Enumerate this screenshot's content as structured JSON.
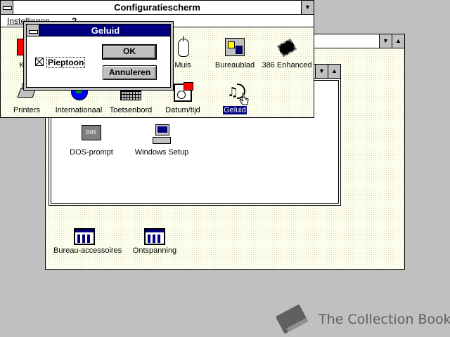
{
  "program_manager": {
    "group_window": {
      "items": [
        {
          "label": "DOS-prompt",
          "icon": "dos-prompt-icon"
        },
        {
          "label": "Windows Setup",
          "icon": "windows-setup-icon"
        }
      ]
    },
    "minimized_groups": [
      {
        "label": "Bureau-accessoires",
        "icon": "program-group-icon"
      },
      {
        "label": "Ontspanning",
        "icon": "program-group-icon"
      }
    ]
  },
  "control_panel": {
    "title": "Configuratiescherm",
    "menu": {
      "settings": "Instellingen",
      "help": "?"
    },
    "icons": [
      {
        "label": "K",
        "icon": "color-icon"
      },
      {
        "label": "Muis",
        "icon": "mouse-icon"
      },
      {
        "label": "Bureaublad",
        "icon": "desktop-icon"
      },
      {
        "label": "386 Enhanced",
        "icon": "chip-icon"
      },
      {
        "label": "Printers",
        "icon": "printer-icon"
      },
      {
        "label": "Internationaal",
        "icon": "globe-icon"
      },
      {
        "label": "Toetsenbord",
        "icon": "keyboard-icon"
      },
      {
        "label": "Datum/tijd",
        "icon": "clock-icon"
      },
      {
        "label": "Geluid",
        "icon": "sound-icon",
        "selected": true
      }
    ]
  },
  "sound_dialog": {
    "title": "Geluid",
    "checkbox_label": "Pieptoon",
    "checkbox_checked": true,
    "ok_label": "OK",
    "cancel_label": "Annuleren"
  },
  "watermark": {
    "text": "The Collection Book"
  },
  "colors": {
    "selection": "#000080",
    "desktop": "#c0c0c0",
    "icon_accent": "#ff0000"
  }
}
